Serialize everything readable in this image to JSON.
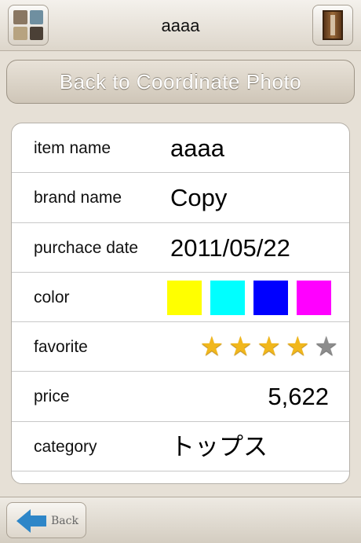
{
  "navbar": {
    "title": "aaaa",
    "left_icon": "coordinate-photos-icon",
    "right_icon": "closet-icon"
  },
  "back_photo_button": {
    "label": "Back to Coordinate Photo"
  },
  "details": {
    "item_name": {
      "label": "item name",
      "value": "aaaa"
    },
    "brand_name": {
      "label": "brand name",
      "value": "Copy"
    },
    "purchase_date": {
      "label": "purchace date",
      "value": "2011/05/22"
    },
    "color": {
      "label": "color",
      "swatches": [
        "#ffff00",
        "#00ffff",
        "#0000ff",
        "#ff00ff"
      ]
    },
    "favorite": {
      "label": "favorite",
      "rating": 4,
      "max": 5
    },
    "price": {
      "label": "price",
      "value": "5,622"
    },
    "category": {
      "label": "category",
      "value": "トップス"
    }
  },
  "toolbar": {
    "back_label": "Back",
    "back_icon": "back-arrow-icon"
  }
}
